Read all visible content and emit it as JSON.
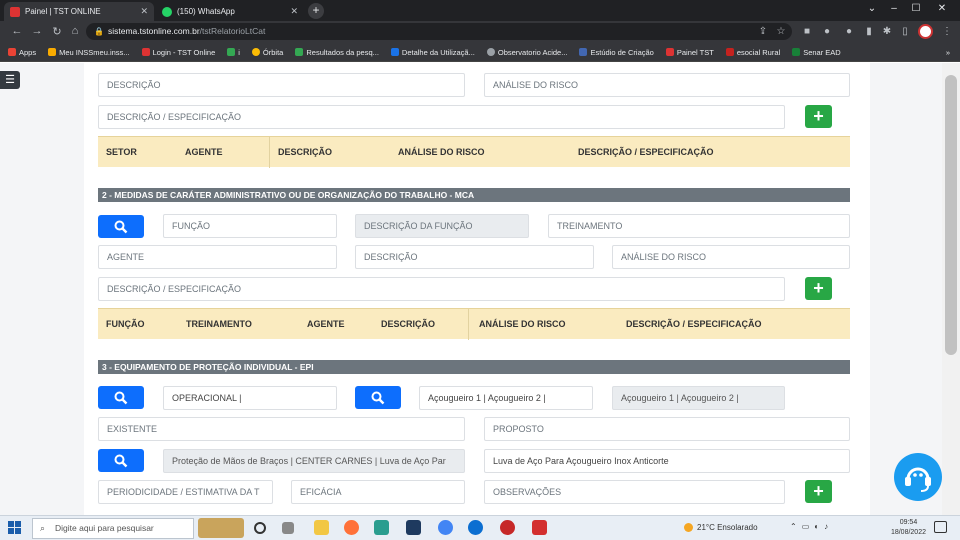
{
  "browser": {
    "tabs": [
      {
        "title": "Painel | TST ONLINE",
        "active": true
      },
      {
        "title": "(150) WhatsApp",
        "active": false
      }
    ],
    "url_host": "sistema.tstonline.com.br",
    "url_path": "/tstRelatorioLtCat",
    "bookmarks": [
      "Apps",
      "Meu INSSmeu.inss...",
      "Login - TST Online",
      "i",
      "Órbita",
      "Resultados da pesq...",
      "Detalhe da Utilizaçã...",
      "Observatorio Acide...",
      "Estúdio de Criação",
      "Painel TST",
      "esocial Rural",
      "Senar EAD"
    ],
    "more": "»"
  },
  "page": {
    "menu_icon": "hamburger-icon",
    "top": {
      "descricao_ph": "DESCRIÇÃO",
      "analise_ph": "ANÁLISE DO RISCO",
      "especificacao_ph": "DESCRIÇÃO / ESPECIFICAÇÃO"
    },
    "table1": {
      "headers": [
        "SETOR",
        "AGENTE",
        "DESCRIÇÃO",
        "ANÁLISE DO RISCO",
        "DESCRIÇÃO / ESPECIFICAÇÃO"
      ]
    },
    "section2": {
      "title": "2 - MEDIDAS DE CARÁTER ADMINISTRATIVO OU DE ORGANIZAÇÃO DO TRABALHO - MCA",
      "funcao_ph": "FUNÇÃO",
      "descricao_funcao_ph": "DESCRIÇÃO DA FUNÇÃO",
      "treinamento_ph": "TREINAMENTO",
      "agente_ph": "AGENTE",
      "descricao_ph": "DESCRIÇÃO",
      "analise_ph": "ANÁLISE DO RISCO",
      "especificacao_ph": "DESCRIÇÃO / ESPECIFICAÇÃO",
      "headers": [
        "FUNÇÃO",
        "TREINAMENTO",
        "AGENTE",
        "DESCRIÇÃO",
        "ANÁLISE DO RISCO",
        "DESCRIÇÃO / ESPECIFICAÇÃO"
      ]
    },
    "section3": {
      "title": "3 - EQUIPAMENTO DE PROTEÇÃO INDIVIDUAL - EPI",
      "operacional": "OPERACIONAL |",
      "acougueiro": "Açougueiro 1  | Açougueiro 2  |",
      "acougueiro_ro": "Açougueiro 1  | Açougueiro 2  |",
      "existente_ph": "EXISTENTE",
      "proposto_ph": "PROPOSTO",
      "epi_value": "Proteção de Mãos de Braços | CENTER CARNES | Luva de Aço Par",
      "epi_desc": "Luva de Aço Para Açougueiro Inox Anticorte",
      "periodicidade_ph": "PERIODICIDADE / ESTIMATIVA DA T",
      "eficacia_ph": "EFICÁCIA",
      "observacoes_ph": "OBSERVAÇÕES"
    },
    "add_label": "+"
  },
  "taskbar": {
    "search_ph": "Digite aqui para pesquisar",
    "weather": "21°C  Ensolarado",
    "time": "09:54",
    "date": "18/08/2022"
  },
  "colors": {
    "primary": "#0d6efd",
    "success": "#28a745",
    "section": "#6c757d",
    "table_head": "#faebc0"
  }
}
